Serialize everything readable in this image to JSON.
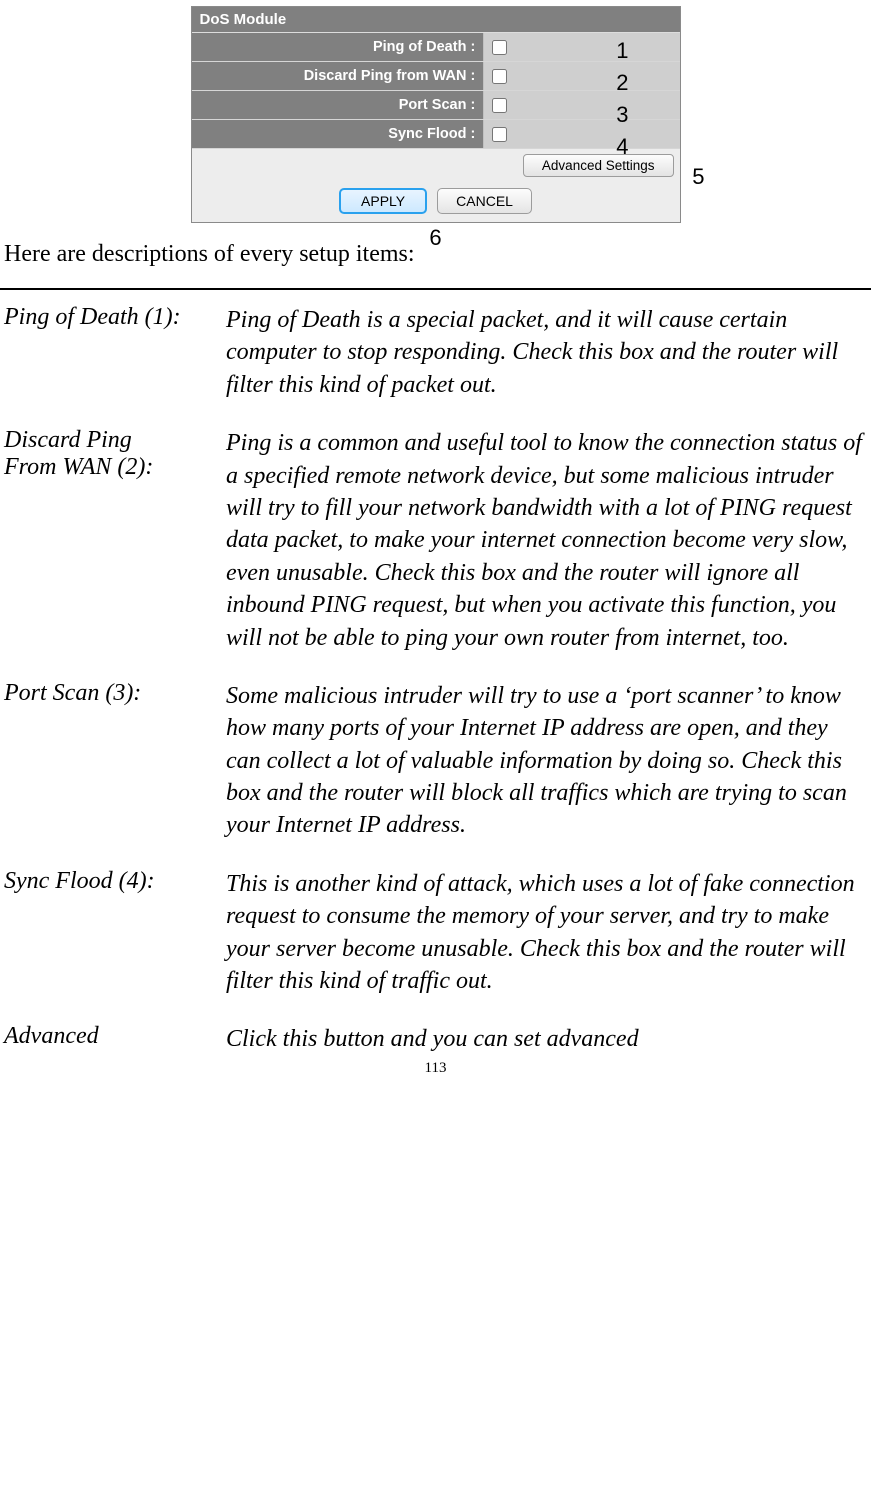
{
  "panel": {
    "title": "DoS Module",
    "rows": [
      {
        "label": "Ping of Death :",
        "annot": "1"
      },
      {
        "label": "Discard Ping from WAN :",
        "annot": "2"
      },
      {
        "label": "Port Scan :",
        "annot": "3"
      },
      {
        "label": "Sync Flood :",
        "annot": "4"
      }
    ],
    "advanced_label": "Advanced Settings",
    "advanced_annot": "5",
    "apply_label": "APPLY",
    "cancel_label": "CANCEL",
    "apply_annot": "6"
  },
  "intro": "Here are descriptions of every setup items:",
  "defs": [
    {
      "term": "Ping of Death (1):",
      "desc": "Ping of Death is a special packet, and it will cause certain computer to stop responding. Check this box and the router will filter this kind of packet out."
    },
    {
      "term": "Discard Ping\nFrom WAN (2):",
      "desc": "Ping is a common and useful tool to know the connection status of a specified remote network device, but some malicious intruder will try to fill your network bandwidth with a lot of PING request data packet, to make your internet connection become very slow, even unusable. Check this box and the router will ignore all inbound PING request, but when you activate this function, you will not be able to ping your own router from internet, too."
    },
    {
      "term": "Port Scan (3):",
      "desc": "Some malicious intruder will try to use a ‘port scanner’ to know how many ports of your Internet IP address are open, and they can collect a lot of valuable information by doing so. Check this box and the router will block all traffics which are trying to scan your Internet IP address."
    },
    {
      "term": "Sync Flood (4):",
      "desc": "This is another kind of attack, which uses a lot of fake connection request to consume the memory of your server, and try to make your server become unusable. Check this box and the router will filter this kind of traffic out."
    },
    {
      "term": "Advanced",
      "desc": "Click this button and you can set advanced"
    }
  ],
  "page_number": "113"
}
